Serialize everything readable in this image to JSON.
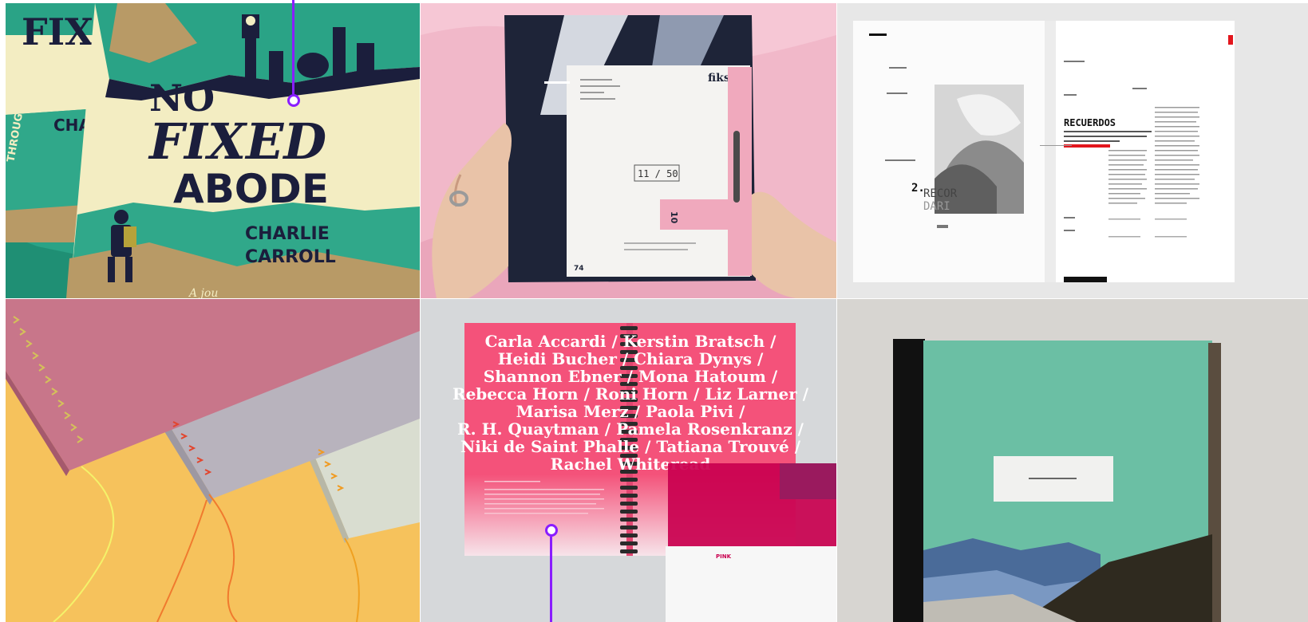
{
  "gallery": {
    "tiles": [
      {
        "cover_title_line1": "NO",
        "cover_title_line2": "FIXED",
        "cover_title_line3": "ABODE",
        "cover_author_line1": "CHARLIE",
        "cover_author_line2": "CARROLL",
        "back_book_title": "FIX ABO",
        "back_book_author": "CHARL CARRO",
        "spine_text": "THROUGH FROM",
        "bottom_fragment": "A jou"
      },
      {
        "brand": "fiks",
        "counter": "11 / 50",
        "tab_number": "10",
        "page_number": "74"
      },
      {
        "heading": "RECUERDOS",
        "subheading": "SON EVOCACIONES MENTALES DE IMÁGENES, SONIDOS, SENSACIONES Y SENTIMIENTOS PASADOS.",
        "feature_number": "2.",
        "feature_text_1": "RECOR",
        "feature_text_2": "DARI"
      },
      {},
      {
        "names_line1": "Carla Accardi / Kerstin Bratsch /",
        "names_line2": "Heidi Bucher / Chiara Dynys /",
        "names_line3": "Shannon Ebner / Mona Hatoum /",
        "names_line4": "Rebecca Horn / Roni Horn / Liz Larner /",
        "names_line5": "Marisa Merz / Paola Pivi /",
        "names_line6": "R. H. Quaytman / Pamela Rosenkranz /",
        "names_line7": "Niki de Saint Phalle / Tatiana Trouvé /",
        "names_line8": "Rachel Whiteread",
        "insert_label": "PINK"
      },
      {}
    ]
  },
  "colors": {
    "guide": "#8a1dff"
  }
}
